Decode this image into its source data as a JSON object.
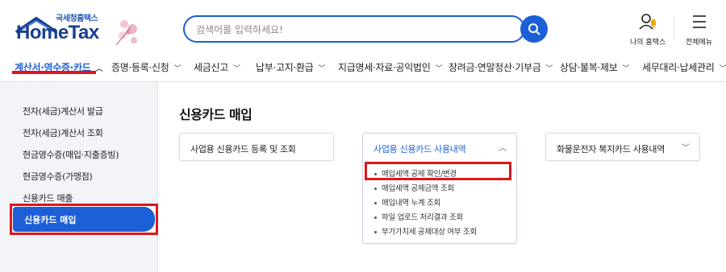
{
  "logo": {
    "subtitle": "국세청홈택스",
    "title": "HomeTax"
  },
  "search": {
    "placeholder": "검색어를 입력하세요!"
  },
  "utils": {
    "my_hometax": "나의 홈택스",
    "all_menu": "전체메뉴"
  },
  "nav": {
    "items": [
      {
        "label": "계산서·영수증·카드",
        "active": true
      },
      {
        "label": "증명·등록·신청"
      },
      {
        "label": "세금신고"
      },
      {
        "label": "납부·고지·환급"
      },
      {
        "label": "지급명세·자료·공익법인"
      },
      {
        "label": "장려금·연말정산·기부금"
      },
      {
        "label": "상담·불복·제보"
      },
      {
        "label": "세무대리·납세관리"
      }
    ]
  },
  "sidebar": {
    "items": [
      {
        "label": "전자(세금)계산서 발급"
      },
      {
        "label": "전자(세금)계산서 조회"
      },
      {
        "label": "현금영수증(매입·지출증빙)"
      },
      {
        "label": "현금영수증(가맹점)"
      },
      {
        "label": "신용카드 매출"
      },
      {
        "label": "신용카드 매입",
        "active": true
      }
    ]
  },
  "main": {
    "title": "신용카드 매입",
    "cards": [
      {
        "label": "사업용 신용카드 등록 및 조회"
      },
      {
        "label": "사업용 신용카드 사용내역",
        "expanded": true,
        "subitems": [
          {
            "label": "매입세액 공제 확인/변경",
            "highlighted": true
          },
          {
            "label": "매입세액 공제금액 조회"
          },
          {
            "label": "매입내역 누계 조회"
          },
          {
            "label": "파일 업로드 처리결과 조회"
          },
          {
            "label": "부가가치세 공제대상 여부 조회"
          }
        ]
      },
      {
        "label": "화물운전자 복지카드 사용내역"
      }
    ]
  },
  "colors": {
    "brand_blue": "#1d5fd6",
    "highlight_red": "#e0151c",
    "sidebar_bg": "#f2f4f8"
  }
}
